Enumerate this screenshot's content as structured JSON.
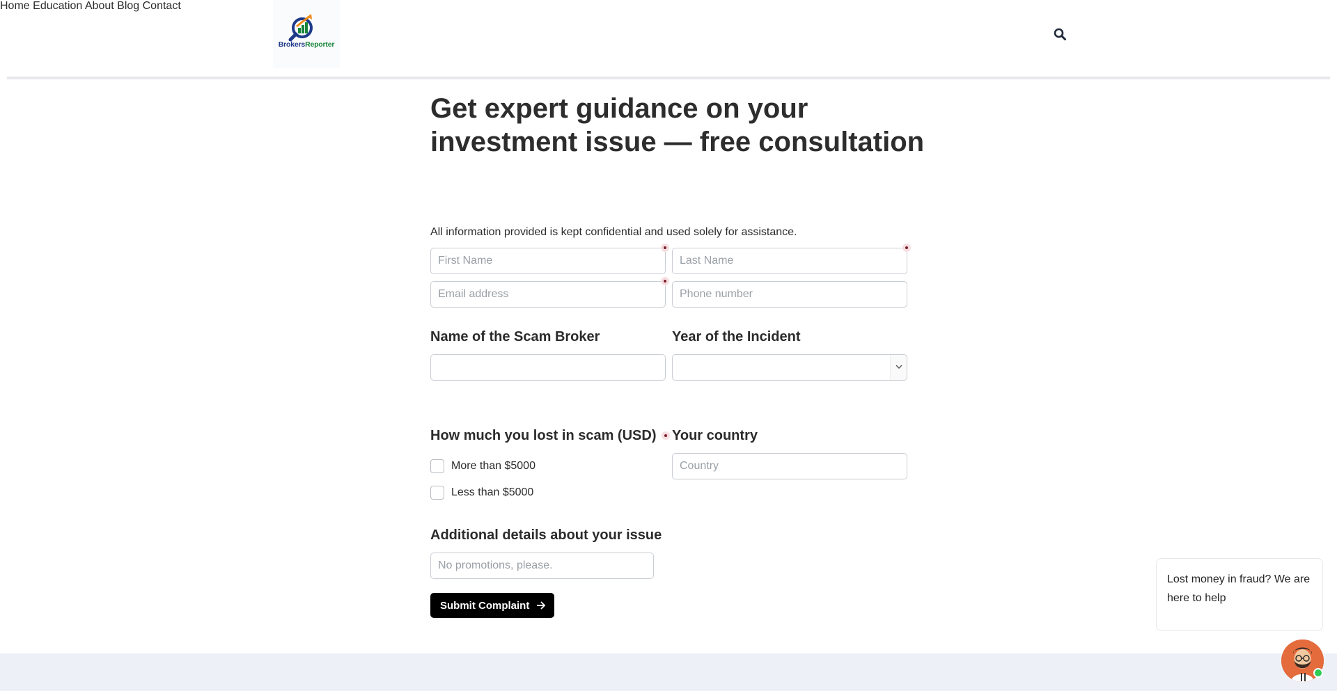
{
  "brand": {
    "name_part1": "Brokers",
    "name_part2": "Reporter"
  },
  "nav": {
    "items": [
      "Home",
      "Education",
      "About",
      "Blog",
      "Contact"
    ]
  },
  "hero": {
    "title": "Get expert guidance on your investment issue — free consultation",
    "privacy_note": "All information provided is kept confidential and used solely for assistance."
  },
  "form": {
    "first_name": {
      "placeholder": "First Name",
      "value": ""
    },
    "last_name": {
      "placeholder": "Last Name",
      "value": ""
    },
    "email": {
      "placeholder": "Email address",
      "value": ""
    },
    "phone": {
      "placeholder": "Phone number",
      "value": ""
    },
    "broker_label": "Name of the Scam Broker",
    "broker_value": "",
    "year_label": "Year of the Incident",
    "year_value": "",
    "loss_label": "How much you lost in scam (USD)",
    "loss_options": [
      "More than $5000",
      "Less than $5000"
    ],
    "country_label": "Your country",
    "country": {
      "placeholder": "Country",
      "value": ""
    },
    "details_label": "Additional details about your issue",
    "details": {
      "placeholder": "No promotions, please.",
      "value": ""
    },
    "submit_label": "Submit Complaint"
  },
  "chat": {
    "message": "Lost money in fraud? We are here to help"
  },
  "colors": {
    "primary_button": "#000000",
    "required_dot": "#7a1f2b",
    "footer_band": "#edf1f7",
    "online": "#2ecc55"
  }
}
